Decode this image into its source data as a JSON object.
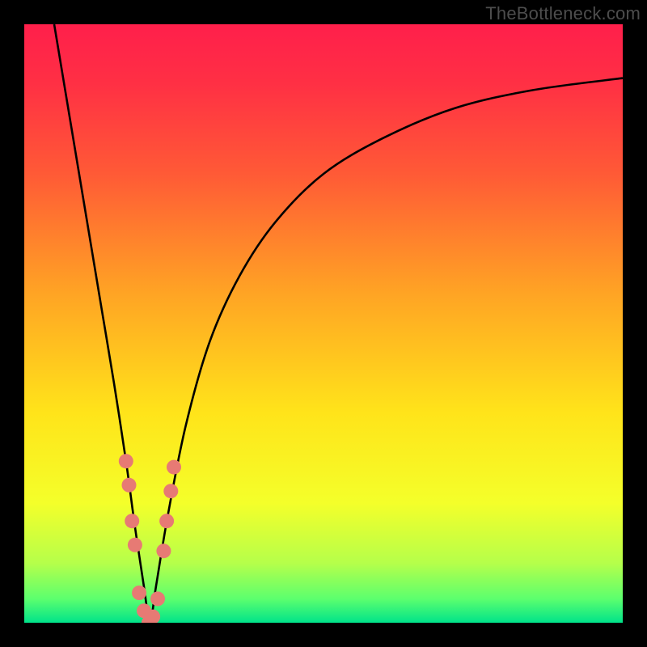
{
  "watermark": "TheBottleneck.com",
  "colors": {
    "frame": "#000000",
    "curve": "#000000",
    "dots": "#e77a74",
    "gradient_stops": [
      {
        "offset": 0.0,
        "color": "#ff1f4b"
      },
      {
        "offset": 0.1,
        "color": "#ff3044"
      },
      {
        "offset": 0.25,
        "color": "#ff5a36"
      },
      {
        "offset": 0.45,
        "color": "#ffa424"
      },
      {
        "offset": 0.65,
        "color": "#ffe41a"
      },
      {
        "offset": 0.8,
        "color": "#f4ff2a"
      },
      {
        "offset": 0.9,
        "color": "#b6ff4a"
      },
      {
        "offset": 0.96,
        "color": "#5cff6e"
      },
      {
        "offset": 1.0,
        "color": "#00e38a"
      }
    ]
  },
  "chart_data": {
    "type": "line",
    "title": "",
    "xlabel": "",
    "ylabel": "",
    "xlim": [
      0,
      100
    ],
    "ylim": [
      0,
      100
    ],
    "series": [
      {
        "name": "curve",
        "x": [
          5,
          7,
          9,
          11,
          13,
          15,
          17,
          18.5,
          20,
          21,
          22,
          24,
          27,
          31,
          36,
          42,
          50,
          60,
          72,
          85,
          100
        ],
        "values": [
          100,
          88,
          76,
          64,
          52,
          40,
          27,
          16,
          6,
          0,
          6,
          18,
          33,
          47,
          58,
          67,
          75,
          81,
          86,
          89,
          91
        ]
      }
    ],
    "annotations": {
      "dots": [
        {
          "x": 17.0,
          "y": 27
        },
        {
          "x": 17.5,
          "y": 23
        },
        {
          "x": 18.0,
          "y": 17
        },
        {
          "x": 18.5,
          "y": 13
        },
        {
          "x": 19.2,
          "y": 5
        },
        {
          "x": 20.0,
          "y": 2
        },
        {
          "x": 20.8,
          "y": 0
        },
        {
          "x": 21.5,
          "y": 1
        },
        {
          "x": 22.3,
          "y": 4
        },
        {
          "x": 23.3,
          "y": 12
        },
        {
          "x": 23.8,
          "y": 17
        },
        {
          "x": 24.5,
          "y": 22
        },
        {
          "x": 25.0,
          "y": 26
        }
      ]
    }
  }
}
